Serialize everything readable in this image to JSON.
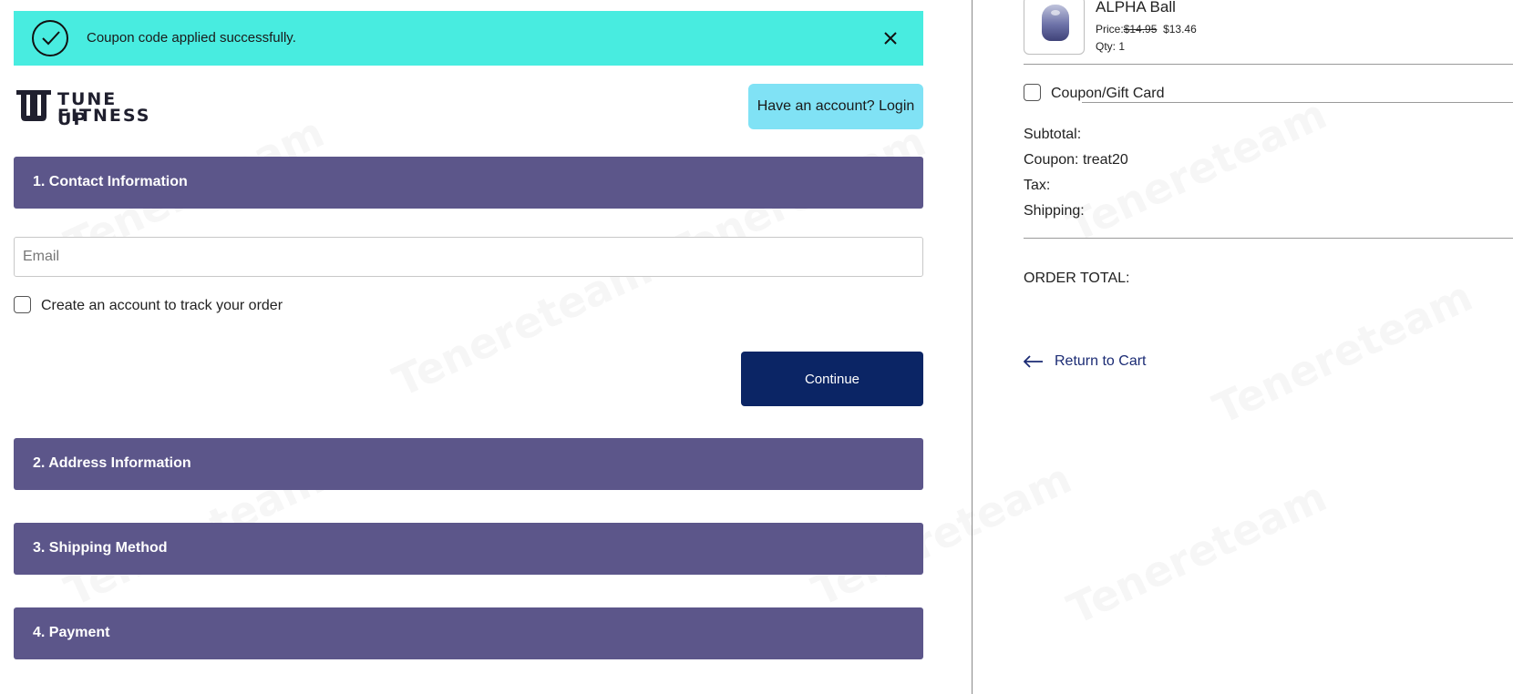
{
  "alert": {
    "message": "Coupon code applied successfully.",
    "icon": "check-circle-icon",
    "close_icon": "close-icon",
    "bg_color": "#48ece0"
  },
  "brand": {
    "logo_line1": "TUNE UP",
    "logo_line2": "FITNESS"
  },
  "header": {
    "login_label": "Have an account? Login"
  },
  "checkout": {
    "sections": [
      {
        "label": "1. Contact Information"
      },
      {
        "label": "2. Address Information"
      },
      {
        "label": "3. Shipping Method"
      },
      {
        "label": "4. Payment"
      }
    ],
    "email_placeholder": "Email",
    "create_account_label": "Create an account to track your order",
    "continue_label": "Continue",
    "section_color": "#5c568a",
    "continue_color": "#0b2565"
  },
  "cart": {
    "item": {
      "name": "ALPHA Ball",
      "price_prefix": "Price:",
      "old_price": "$14.95",
      "new_price": "$13.46",
      "qty": "Qty: 1"
    },
    "coupon_toggle_label": "Coupon/Gift Card",
    "summary": {
      "subtotal_label": "Subtotal:",
      "coupon_label": "Coupon: treat20",
      "tax_label": "Tax:",
      "shipping_label": "Shipping:",
      "order_total_label": "ORDER TOTAL:"
    },
    "return_label": "Return to Cart",
    "return_icon": "arrow-left-icon"
  },
  "watermark": "Tenereteam"
}
